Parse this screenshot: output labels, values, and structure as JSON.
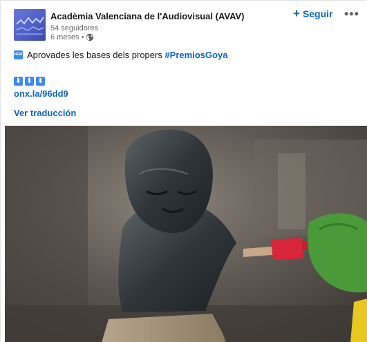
{
  "post": {
    "org_name": "Acadèmia Valenciana de l'Audiovisual (AVAV)",
    "followers": "54 seguidores",
    "time": "6 meses •",
    "follow_label": "Seguir",
    "more_label": "•••",
    "text_before": "Aprovades les bases dels propers ",
    "hashtag": "#PremiosGoya",
    "new_icon_text": "NEW",
    "arrow_glyph": "⬇",
    "link": "onx.la/96dd9",
    "translate": "Ver traducción"
  },
  "colors": {
    "link_blue": "#0a66c2",
    "emoji_blue": "#3d8bf0",
    "avatar_blue": "#5a68cf"
  },
  "icons": [
    "globe-icon",
    "plus-icon",
    "more-icon",
    "new-icon",
    "arrow-down-icon"
  ]
}
